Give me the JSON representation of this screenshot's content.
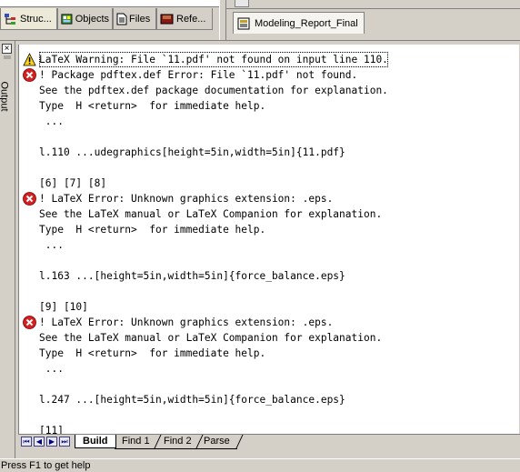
{
  "project_tabs": [
    {
      "label": "Struc...",
      "icon": "structure-icon"
    },
    {
      "label": "Objects",
      "icon": "objects-icon"
    },
    {
      "label": "Files",
      "icon": "files-icon"
    },
    {
      "label": "Refe...",
      "icon": "references-icon"
    }
  ],
  "document_tab": {
    "label": "Modeling_Report_Final",
    "icon": "document-icon"
  },
  "output_panel": {
    "title": "Output",
    "close_symbol": "×",
    "lines": [
      {
        "icon": "warning",
        "text": "LaTeX Warning: File `11.pdf' not found on input line 110."
      },
      {
        "icon": "error",
        "text": "! Package pdftex.def Error: File `11.pdf' not found."
      },
      {
        "icon": "",
        "text": "See the pdftex.def package documentation for explanation."
      },
      {
        "icon": "",
        "text": "Type  H <return>  for immediate help."
      },
      {
        "icon": "",
        "text": " ..."
      },
      {
        "icon": "",
        "text": ""
      },
      {
        "icon": "",
        "text": "l.110 ...udegraphics[height=5in,width=5in]{11.pdf}"
      },
      {
        "icon": "",
        "text": ""
      },
      {
        "icon": "",
        "text": "[6] [7] [8]"
      },
      {
        "icon": "error",
        "text": "! LaTeX Error: Unknown graphics extension: .eps."
      },
      {
        "icon": "",
        "text": "See the LaTeX manual or LaTeX Companion for explanation."
      },
      {
        "icon": "",
        "text": "Type  H <return>  for immediate help."
      },
      {
        "icon": "",
        "text": " ..."
      },
      {
        "icon": "",
        "text": ""
      },
      {
        "icon": "",
        "text": "l.163 ...[height=5in,width=5in]{force_balance.eps}"
      },
      {
        "icon": "",
        "text": ""
      },
      {
        "icon": "",
        "text": "[9] [10]"
      },
      {
        "icon": "error",
        "text": "! LaTeX Error: Unknown graphics extension: .eps."
      },
      {
        "icon": "",
        "text": "See the LaTeX manual or LaTeX Companion for explanation."
      },
      {
        "icon": "",
        "text": "Type  H <return>  for immediate help."
      },
      {
        "icon": "",
        "text": " ..."
      },
      {
        "icon": "",
        "text": ""
      },
      {
        "icon": "",
        "text": "l.247 ...[height=5in,width=5in]{force_balance.eps}"
      },
      {
        "icon": "",
        "text": ""
      },
      {
        "icon": "",
        "text": "[11]"
      }
    ]
  },
  "bottom_tabs": {
    "nav": [
      "⏮",
      "◀",
      "▶",
      "⏭"
    ],
    "items": [
      "Build",
      "Find 1",
      "Find 2",
      "Parse"
    ],
    "active": "Build"
  },
  "status_bar": {
    "text": "Press F1 to get help"
  },
  "colors": {
    "warning": "#f7d21c",
    "error": "#d42020",
    "panel": "#d4d0c8"
  }
}
